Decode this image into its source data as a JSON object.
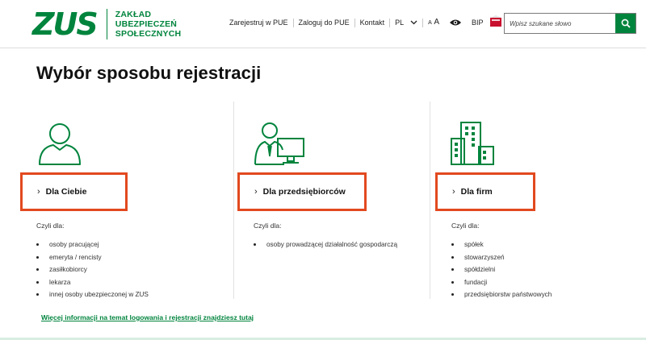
{
  "header": {
    "logo_mark": "ZUS",
    "logo_lines": [
      "ZAKŁAD",
      "UBEZPIECZEŃ",
      "SPOŁECZNYCH"
    ],
    "nav": {
      "register": "Zarejestruj w PUE",
      "login": "Zaloguj do PUE",
      "contact": "Kontakt",
      "lang": "PL",
      "font_small": "A",
      "font_big": "A",
      "bip": "BIP"
    },
    "search": {
      "placeholder": "Wpisz szukane słowo"
    }
  },
  "main": {
    "title": "Wybór sposobu rejestracji",
    "columns": [
      {
        "icon": "person-icon",
        "button": "Dla Ciebie",
        "czyli": "Czyli dla:",
        "items": [
          "osoby pracującej",
          "emeryta / rencisty",
          "zasiłkobiorcy",
          "lekarza",
          "innej osoby ubezpieczonej w ZUS"
        ]
      },
      {
        "icon": "businessman-computer-icon",
        "button": "Dla przedsiębiorców",
        "czyli": "Czyli dla:",
        "items": [
          "osoby prowadzącej działalność gospodarczą"
        ]
      },
      {
        "icon": "buildings-icon",
        "button": "Dla firm",
        "czyli": "Czyli dla:",
        "items": [
          "spółek",
          "stowarzyszeń",
          "spółdzielni",
          "fundacji",
          "przedsiębiorstw państwowych"
        ]
      }
    ],
    "more_link": "Więcej informacji na temat logowania i rejestracji znajdziesz tutaj"
  },
  "colors": {
    "brand_green": "#00843d",
    "highlight_red": "#e2491f"
  }
}
